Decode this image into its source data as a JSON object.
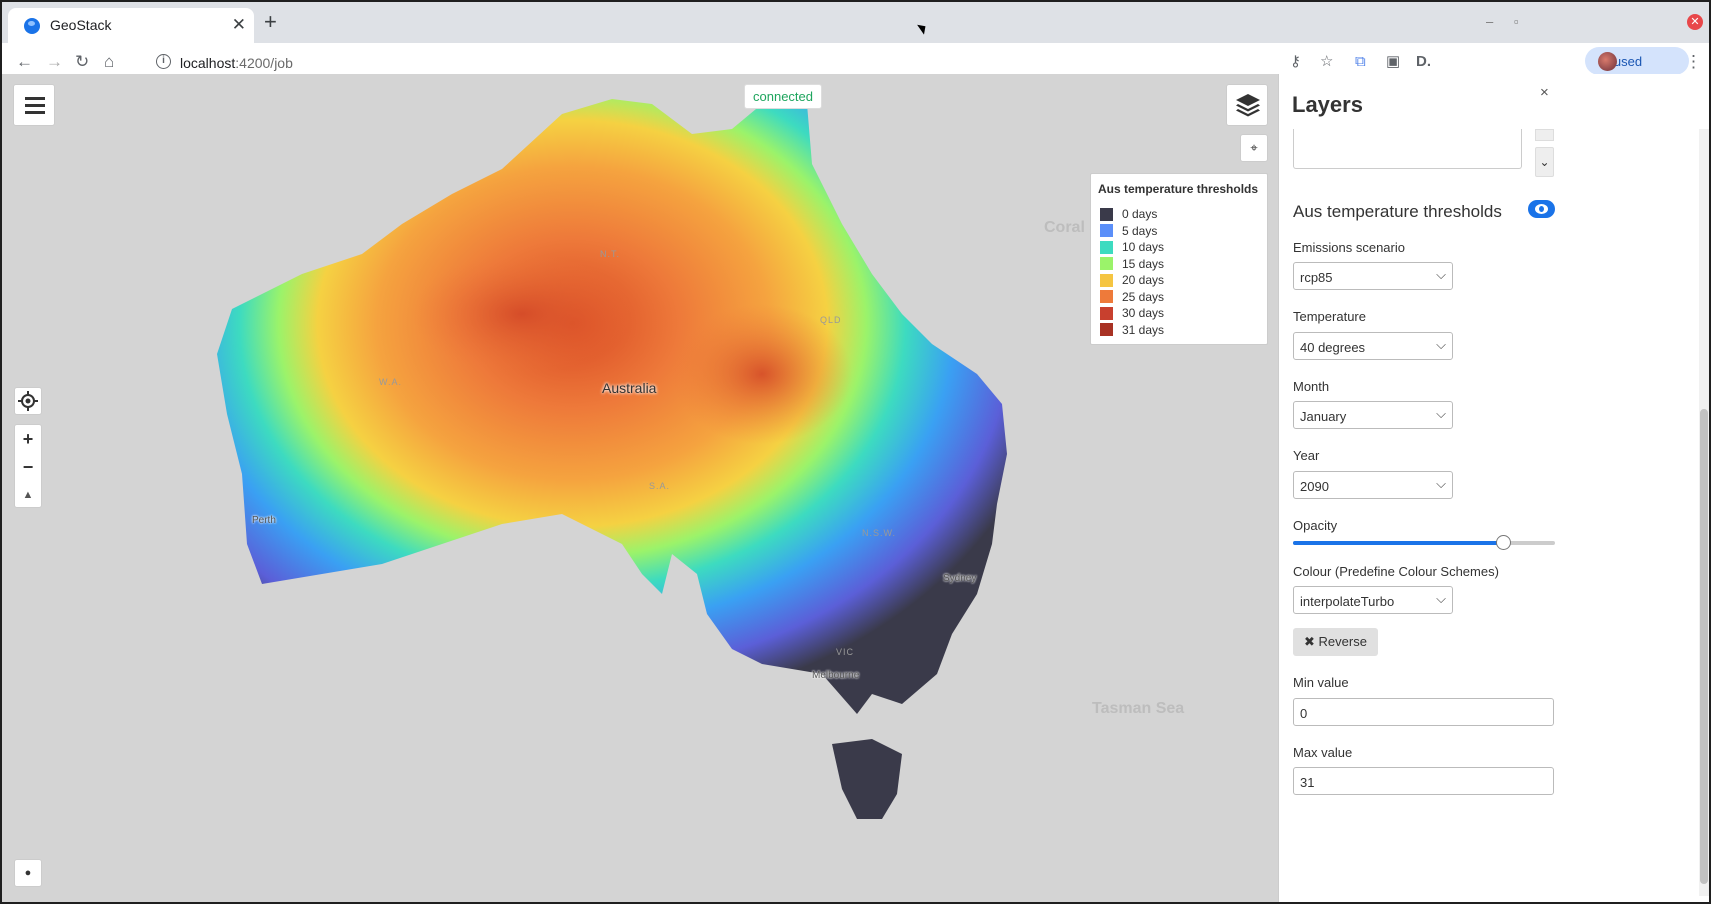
{
  "browser": {
    "tab_title": "GeoStack",
    "tab_close": "✕",
    "new_tab": "+",
    "url_host": "localhost",
    "url_path": ":4200/job",
    "paused_label": "Paused",
    "back_icon": "←",
    "forward_icon": "→",
    "reload_icon": "↻",
    "home_icon": "⌂",
    "menu_icon": "⋮"
  },
  "map": {
    "status": "connected",
    "labels": {
      "coral_sea": "Coral S",
      "tasman_sea": "Tasman Sea",
      "australia": "Australia",
      "perth": "Perth",
      "sydney": "Sydney",
      "melbourne": "Melbourne",
      "nt": "N.T.",
      "qld": "QLD",
      "wa": "W.A.",
      "sa": "S.A.",
      "nsw": "N.S.W.",
      "vic": "VIC"
    },
    "controls": {
      "zoom_in": "+",
      "zoom_out": "−",
      "compass": "▲",
      "target": "⌖",
      "attribution": "●"
    }
  },
  "legend": {
    "title": "Aus temperature thresholds",
    "items": [
      {
        "label": "0 days",
        "color": "#3a3a4a"
      },
      {
        "label": "5 days",
        "color": "#5b8ff9"
      },
      {
        "label": "10 days",
        "color": "#3ddbc0"
      },
      {
        "label": "15 days",
        "color": "#9bf36a"
      },
      {
        "label": "20 days",
        "color": "#f5c542"
      },
      {
        "label": "25 days",
        "color": "#ee7a3a"
      },
      {
        "label": "30 days",
        "color": "#c8402e"
      },
      {
        "label": "31 days",
        "color": "#a83224"
      }
    ]
  },
  "panel": {
    "title": "Layers",
    "close": "×",
    "layer_name": "Aus temperature thresholds",
    "expand_icon": "⌄",
    "fields": {
      "emissions_label": "Emissions scenario",
      "emissions_value": "rcp85",
      "temperature_label": "Temperature",
      "temperature_value": "40 degrees",
      "month_label": "Month",
      "month_value": "January",
      "year_label": "Year",
      "year_value": "2090",
      "opacity_label": "Opacity",
      "opacity_value": 0.8,
      "colour_label": "Colour (Predefine Colour Schemes)",
      "colour_value": "interpolateTurbo",
      "reverse_label": "✖ Reverse",
      "min_label": "Min value",
      "min_value": "0",
      "max_label": "Max value",
      "max_value": "31"
    },
    "chevron": "⌵"
  }
}
